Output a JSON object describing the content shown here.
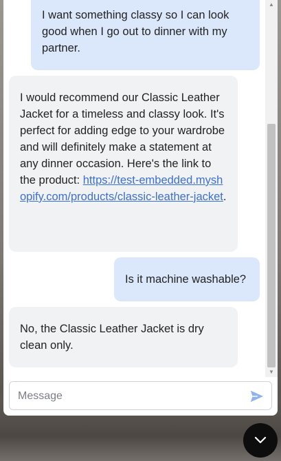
{
  "messages": [
    {
      "role": "user",
      "text": "I want something classy so I can look good when I go out to dinner with my partner."
    },
    {
      "role": "assistant",
      "text_before_link": "I would recommend our Classic Leather Jacket for a timeless and classy look. It's perfect for adding edge to your wardrobe and will definitely make a statement at any dinner occasion. Here's the link to the product: ",
      "link_text": "https://test-embedded.myshopify.com/products/classic-leather-jacket",
      "text_after_link": "."
    },
    {
      "role": "user",
      "text": "Is it machine washable?"
    },
    {
      "role": "assistant",
      "text": "No, the Classic Leather Jacket is dry clean only."
    }
  ],
  "input": {
    "placeholder": "Message",
    "value": ""
  },
  "icons": {
    "send": "send-icon",
    "toggle": "chevron-down-icon",
    "scroll_up": "arrow-up-icon",
    "scroll_down": "arrow-down-icon"
  },
  "colors": {
    "user_bubble": "#dbe8fb",
    "bot_bubble": "#f1f2f4",
    "link": "#3b6fd4",
    "send_icon": "#8fb3ee",
    "toggle_button": "#0d0d0d"
  }
}
